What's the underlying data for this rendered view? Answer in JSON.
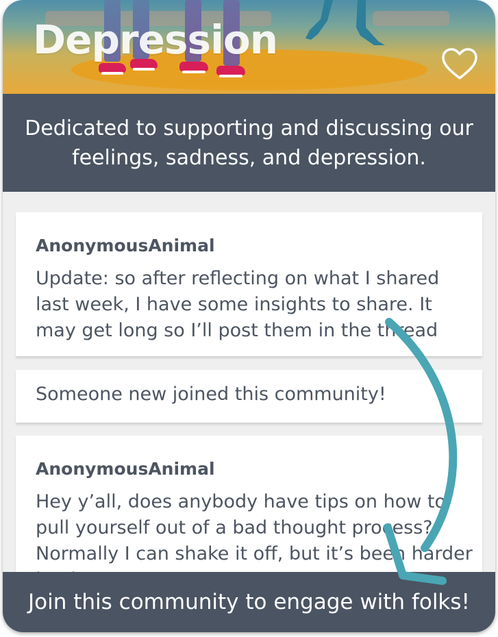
{
  "header": {
    "title": "Depression",
    "favorite_icon": "heart-outline-icon"
  },
  "description": "Dedicated to supporting and discussing our feelings, sadness, and depression.",
  "feed": {
    "posts": [
      {
        "author": "AnonymousAnimal",
        "body": "Update: so after reflecting on what I shared last week, I have some insights to share. It may get long so I’ll post them in the thread"
      },
      {
        "notice": "Someone new joined this community!"
      },
      {
        "author": "AnonymousAnimal",
        "body": "Hey y’all, does anybody have tips on how to pull yourself out of a bad thought process? Normally I can shake it off, but it’s been harder lately"
      }
    ]
  },
  "join_bar": {
    "label": "Join this community to engage with folks!"
  },
  "colors": {
    "dark_slate": "#4a5462",
    "text_gray": "#4d5561",
    "arrow_teal": "#4aa6b4",
    "banner_orange": "#e9a93a"
  }
}
